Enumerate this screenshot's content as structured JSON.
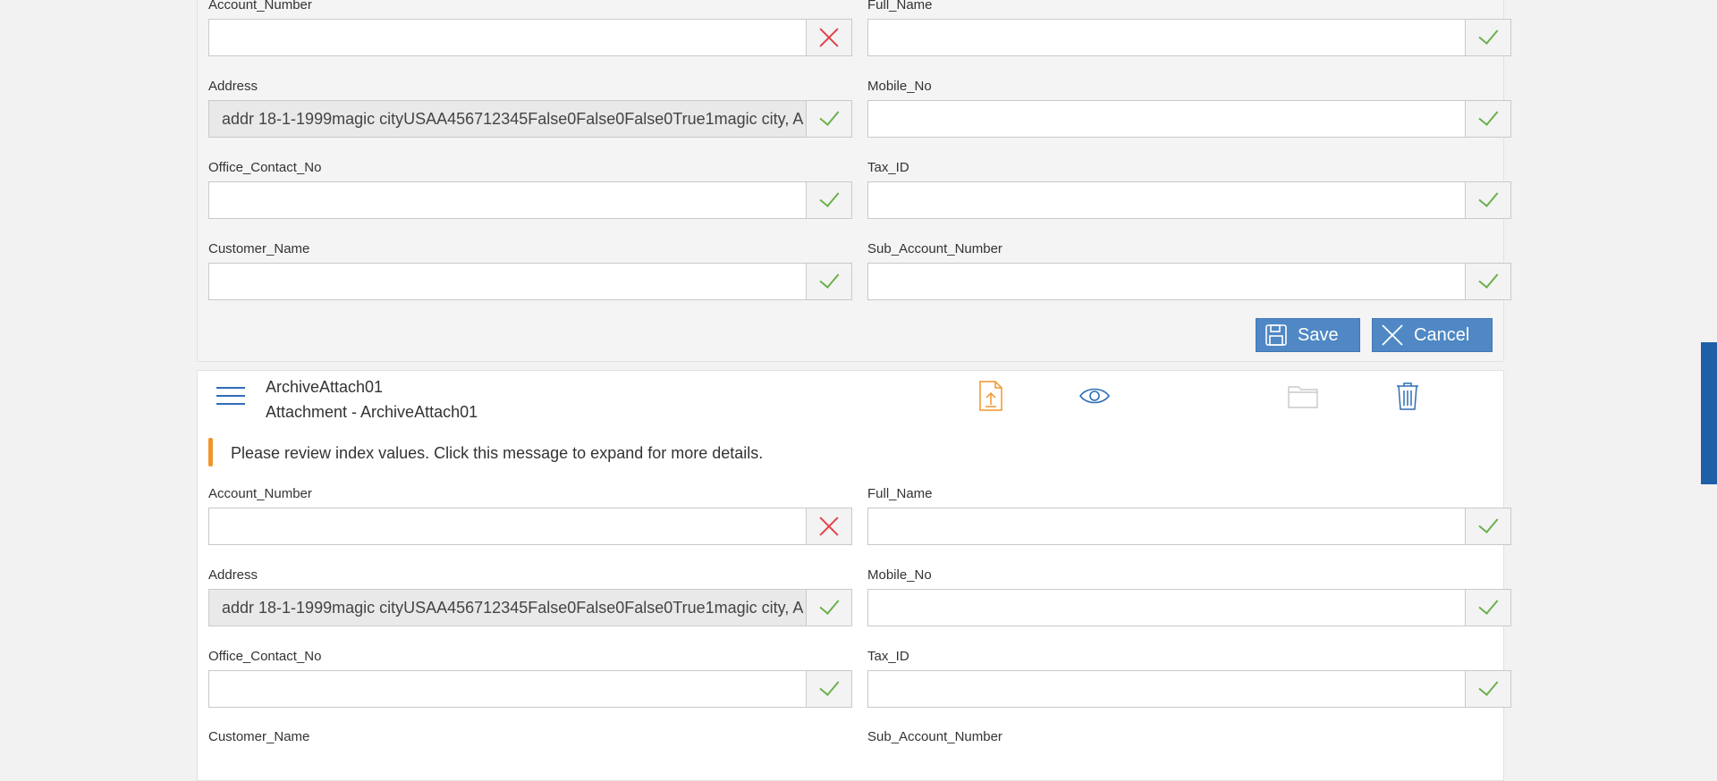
{
  "top_form": {
    "fields": [
      {
        "label": "Account_Number",
        "value": "",
        "status": "invalid"
      },
      {
        "label": "Full_Name",
        "value": "",
        "status": "valid"
      },
      {
        "label": "Address",
        "value": "addr 18-1-1999magic cityUSAA456712345False0False0False0True1magic city, A",
        "status": "valid"
      },
      {
        "label": "Mobile_No",
        "value": "",
        "status": "valid"
      },
      {
        "label": "Office_Contact_No",
        "value": "",
        "status": "valid"
      },
      {
        "label": "Tax_ID",
        "value": "",
        "status": "valid"
      },
      {
        "label": "Customer_Name",
        "value": "",
        "status": "valid"
      },
      {
        "label": "Sub_Account_Number",
        "value": "",
        "status": "valid"
      }
    ],
    "save_label": "Save",
    "cancel_label": "Cancel"
  },
  "attachment": {
    "title": "ArchiveAttach01",
    "subtitle": "Attachment - ArchiveAttach01",
    "message": "Please review index values. Click this message to expand for more details.",
    "icons": [
      "upload-icon",
      "eye-icon",
      "folder-icon",
      "trash-icon"
    ],
    "fields": [
      {
        "label": "Account_Number",
        "value": "",
        "status": "invalid"
      },
      {
        "label": "Full_Name",
        "value": "",
        "status": "valid"
      },
      {
        "label": "Address",
        "value": "addr 18-1-1999magic cityUSAA456712345False0False0False0True1magic city, A",
        "status": "valid"
      },
      {
        "label": "Mobile_No",
        "value": "",
        "status": "valid"
      },
      {
        "label": "Office_Contact_No",
        "value": "",
        "status": "valid"
      },
      {
        "label": "Tax_ID",
        "value": "",
        "status": "valid"
      },
      {
        "label": "Customer_Name",
        "value": "",
        "status": "valid"
      },
      {
        "label": "Sub_Account_Number",
        "value": "",
        "status": "valid"
      }
    ]
  },
  "colors": {
    "accent": "#4f88c4",
    "valid": "#6ab04c",
    "invalid": "#e2434b",
    "warning": "#f0952c",
    "side_tab": "#1f5fa8"
  }
}
